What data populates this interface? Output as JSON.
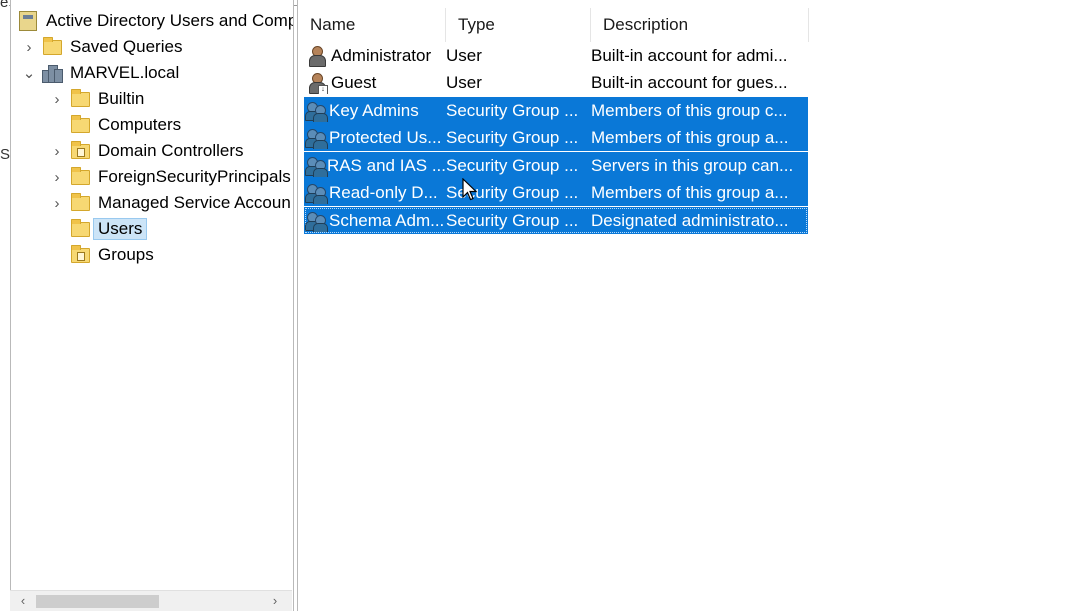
{
  "left_edge": {
    "fragments": [
      "e",
      "S"
    ]
  },
  "tree": {
    "root": {
      "label": "Active Directory Users and Comp",
      "icon": "aduc-console-icon"
    },
    "items": [
      {
        "label": "Saved Queries",
        "icon": "folder-icon",
        "expander": "›"
      },
      {
        "label": "MARVEL.local",
        "icon": "domain-icon",
        "expander": "⌄"
      },
      {
        "label": "Builtin",
        "icon": "folder-icon",
        "expander": "›"
      },
      {
        "label": "Computers",
        "icon": "folder-icon",
        "expander": ""
      },
      {
        "label": "Domain Controllers",
        "icon": "ou-folder-icon",
        "expander": "›"
      },
      {
        "label": "ForeignSecurityPrincipals",
        "icon": "folder-icon",
        "expander": "›"
      },
      {
        "label": "Managed Service Accoun",
        "icon": "folder-icon",
        "expander": "›"
      },
      {
        "label": "Users",
        "icon": "folder-icon",
        "expander": "",
        "selected": true
      },
      {
        "label": "Groups",
        "icon": "ou-folder-icon",
        "expander": ""
      }
    ],
    "scroll_left": "‹",
    "scroll_right": "›"
  },
  "list": {
    "columns": [
      "Name",
      "Type",
      "Description"
    ],
    "rows": [
      {
        "name": "Administrator",
        "type": "User",
        "description": "Built-in account for admi...",
        "icon": "user-icon",
        "selected": false
      },
      {
        "name": "Guest",
        "type": "User",
        "description": "Built-in account for gues...",
        "icon": "guest-user-icon",
        "selected": false
      },
      {
        "name": "Key Admins",
        "type": "Security Group ...",
        "description": "Members of this group c...",
        "icon": "group-icon",
        "selected": true
      },
      {
        "name": "Protected Us...",
        "type": "Security Group ...",
        "description": "Members of this group a...",
        "icon": "group-icon",
        "selected": true
      },
      {
        "name": "RAS and IAS ...",
        "type": "Security Group ...",
        "description": "Servers in this group can...",
        "icon": "group-icon",
        "selected": true
      },
      {
        "name": "Read-only D...",
        "type": "Security Group ...",
        "description": "Members of this group a...",
        "icon": "group-icon",
        "selected": true
      },
      {
        "name": "Schema Adm...",
        "type": "Security Group ...",
        "description": "Designated administrato...",
        "icon": "group-icon",
        "selected": true
      }
    ]
  },
  "colors": {
    "selection": "#0a78d7",
    "tree_selection": "#cce4f7",
    "folder": "#f7d873"
  }
}
